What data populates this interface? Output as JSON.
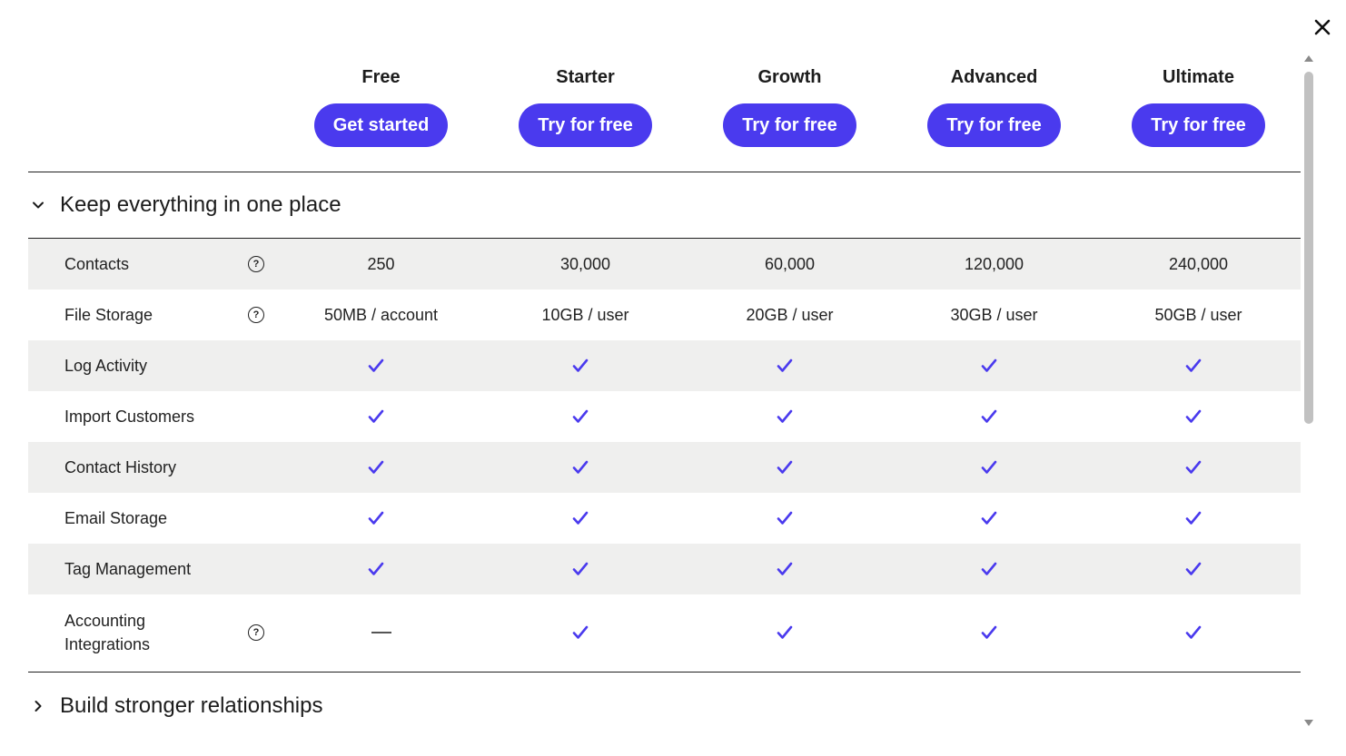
{
  "plans": [
    {
      "name": "Free",
      "button": "Get started"
    },
    {
      "name": "Starter",
      "button": "Try for free"
    },
    {
      "name": "Growth",
      "button": "Try for free"
    },
    {
      "name": "Advanced",
      "button": "Try for free"
    },
    {
      "name": "Ultimate",
      "button": "Try for free"
    }
  ],
  "sections": [
    {
      "title": "Keep everything in one place",
      "expanded": true
    },
    {
      "title": "Build stronger relationships",
      "expanded": false
    }
  ],
  "features": [
    {
      "label": "Contacts",
      "info": true,
      "values": [
        "250",
        "30,000",
        "60,000",
        "120,000",
        "240,000"
      ]
    },
    {
      "label": "File Storage",
      "info": true,
      "values": [
        "50MB / account",
        "10GB / user",
        "20GB / user",
        "30GB / user",
        "50GB / user"
      ]
    },
    {
      "label": "Log Activity",
      "info": false,
      "values": [
        "check",
        "check",
        "check",
        "check",
        "check"
      ]
    },
    {
      "label": "Import Customers",
      "info": false,
      "values": [
        "check",
        "check",
        "check",
        "check",
        "check"
      ]
    },
    {
      "label": "Contact History",
      "info": false,
      "values": [
        "check",
        "check",
        "check",
        "check",
        "check"
      ]
    },
    {
      "label": "Email Storage",
      "info": false,
      "values": [
        "check",
        "check",
        "check",
        "check",
        "check"
      ]
    },
    {
      "label": "Tag Management",
      "info": false,
      "values": [
        "check",
        "check",
        "check",
        "check",
        "check"
      ]
    },
    {
      "label": "Accounting Integrations",
      "info": true,
      "values": [
        "dash",
        "check",
        "check",
        "check",
        "check"
      ]
    }
  ],
  "icons": {
    "close": "close-icon",
    "info": "question-circle-icon",
    "check": "check-icon",
    "collapse": "chevron-down-icon",
    "expand": "chevron-right-icon"
  },
  "colors": {
    "accent": "#4a3aee",
    "check": "#4a3aee",
    "row_shade": "#efefee"
  }
}
